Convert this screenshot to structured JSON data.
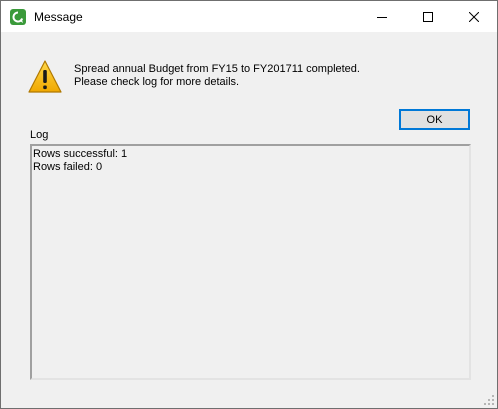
{
  "window": {
    "title": "Message",
    "controls": {
      "minimize_icon": "minimize-icon",
      "maximize_icon": "maximize-icon",
      "close_icon": "close-icon"
    }
  },
  "message": {
    "icon": "warning-icon",
    "line1": "Spread annual Budget from FY15 to FY201711 completed.",
    "line2": "Please check log for more details."
  },
  "buttons": {
    "ok_label": "OK"
  },
  "log": {
    "label": "Log",
    "lines": [
      "Rows successful: 1",
      "Rows failed: 0"
    ]
  },
  "colors": {
    "accent": "#0078d7",
    "warning": "#f2b600",
    "app_icon": "#3a9a3a"
  }
}
